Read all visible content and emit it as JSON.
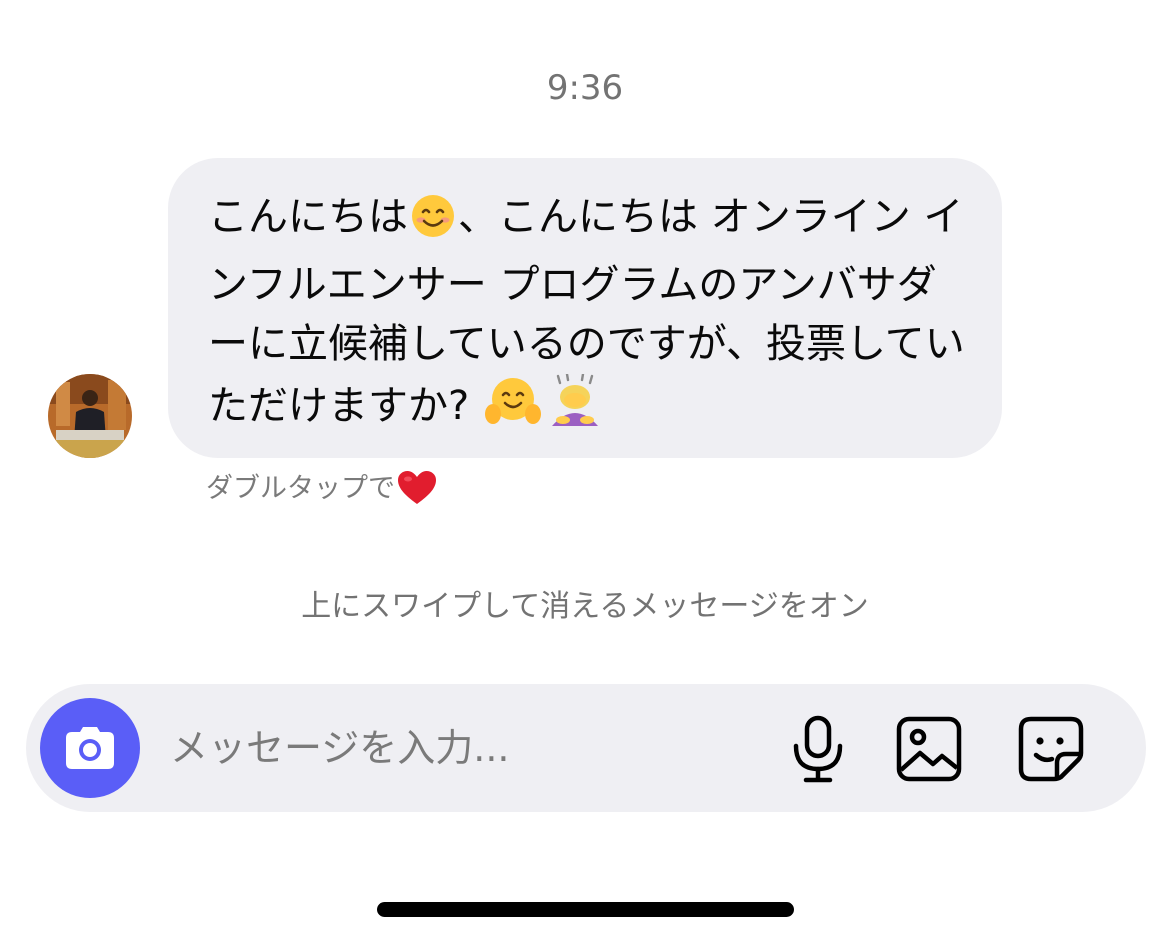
{
  "thread": {
    "timestamp": "9:36"
  },
  "message": {
    "text_1": "こんにちは",
    "text_2": "、こんにちは オンライン インフルエンサー プログラムのアンバサダーに立候補しているのですが、投票していただけますか? ",
    "emojis": [
      "smiling-face-icon",
      "hugging-face-icon",
      "bowing-woman-icon"
    ]
  },
  "reaction_hint": {
    "label": "ダブルタップで",
    "icon": "red-heart-icon"
  },
  "vanish_mode": {
    "label": "上にスワイプして消えるメッセージをオン"
  },
  "composer": {
    "placeholder": "メッセージを入力...",
    "icons": [
      "camera-icon",
      "microphone-icon",
      "image-icon",
      "sticker-icon"
    ]
  },
  "colors": {
    "accent": "#5a5ef7",
    "bubble": "#efeff3",
    "secondary_text": "#737373"
  }
}
